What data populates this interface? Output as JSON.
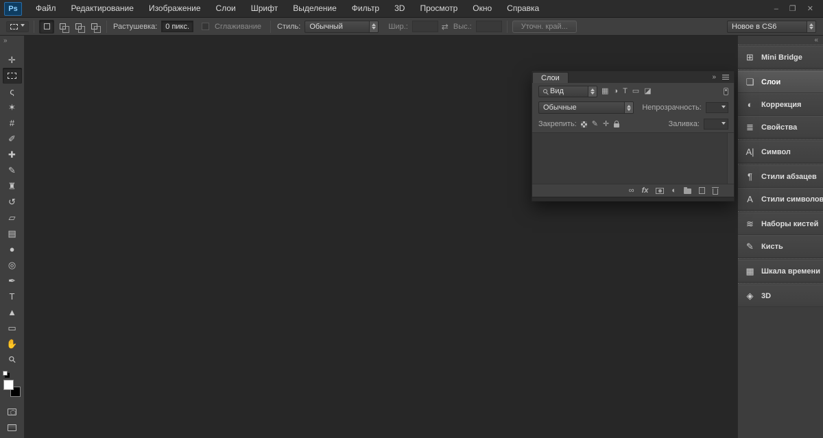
{
  "app": {
    "logo": "Ps",
    "menus": [
      "Файл",
      "Редактирование",
      "Изображение",
      "Слои",
      "Шрифт",
      "Выделение",
      "Фильтр",
      "3D",
      "Просмотр",
      "Окно",
      "Справка"
    ],
    "window_controls": [
      {
        "name": "minimize-button",
        "glyph": "–"
      },
      {
        "name": "restore-button",
        "glyph": "❐"
      },
      {
        "name": "close-button",
        "glyph": "✕"
      }
    ]
  },
  "options_bar": {
    "selection_modes": [
      {
        "name": "new-selection-button",
        "pressed": true
      },
      {
        "name": "add-selection-button",
        "dbl": true
      },
      {
        "name": "subtract-selection-button",
        "dbl": true
      },
      {
        "name": "intersect-selection-button",
        "dbl": true
      }
    ],
    "feather_label": "Растушевка:",
    "feather_value": "0 пикс.",
    "antialias_label": "Сглаживание",
    "style_label": "Стиль:",
    "style_value": "Обычный",
    "width_label": "Шир.:",
    "width_value": "",
    "swap_icon": "⇄",
    "height_label": "Выс.:",
    "height_value": "",
    "refine_edge_label": "Уточн. край...",
    "workspace_value": "Новое в CS6"
  },
  "toolbar": {
    "expand_icon": "»",
    "tools": [
      {
        "name": "move-tool",
        "glyph": "✛"
      },
      {
        "name": "rectangular-marquee-tool",
        "css": "marquee",
        "selected": true
      },
      {
        "name": "lasso-tool",
        "glyph": "ς"
      },
      {
        "name": "quick-selection-tool",
        "glyph": "✶"
      },
      {
        "name": "crop-tool",
        "glyph": "#"
      },
      {
        "name": "eyedropper-tool",
        "glyph": "✐"
      },
      {
        "name": "healing-brush-tool",
        "glyph": "✚"
      },
      {
        "name": "brush-tool",
        "glyph": "✎"
      },
      {
        "name": "clone-stamp-tool",
        "glyph": "♜"
      },
      {
        "name": "history-brush-tool",
        "glyph": "↺"
      },
      {
        "name": "eraser-tool",
        "glyph": "▱"
      },
      {
        "name": "gradient-tool",
        "glyph": "▤"
      },
      {
        "name": "blur-tool",
        "glyph": "●"
      },
      {
        "name": "dodge-tool",
        "glyph": "◎"
      },
      {
        "name": "pen-tool",
        "glyph": "✒"
      },
      {
        "name": "type-tool",
        "glyph": "T"
      },
      {
        "name": "path-selection-tool",
        "glyph": "▲"
      },
      {
        "name": "rectangle-tool",
        "glyph": "▭"
      },
      {
        "name": "hand-tool",
        "glyph": "✋"
      },
      {
        "name": "zoom-tool",
        "glyph": "⚲",
        "rot": true
      }
    ],
    "foreground_color": "#ffffff",
    "background_color": "#000000",
    "tools_bottom": [
      {
        "name": "quick-mask-button",
        "css": "quickmask"
      },
      {
        "name": "screen-mode-button",
        "css": "screenmode"
      }
    ]
  },
  "layers_panel": {
    "title": "Слои",
    "collapse_icon": "»",
    "filter_label": "Вид",
    "filter_icons": [
      {
        "name": "pixel-filter-icon",
        "glyph": "▦"
      },
      {
        "name": "adjustment-filter-icon",
        "glyph": "◑"
      },
      {
        "name": "type-filter-icon",
        "glyph": "T"
      },
      {
        "name": "shape-filter-icon",
        "glyph": "▭"
      },
      {
        "name": "smart-object-filter-icon",
        "glyph": "◪"
      }
    ],
    "blend_mode_value": "Обычные",
    "opacity_label": "Непрозрачность:",
    "opacity_value": "",
    "lock_label": "Закрепить:",
    "lock_icons": [
      {
        "name": "lock-transparency-icon",
        "css": "checker"
      },
      {
        "name": "lock-pixels-icon",
        "glyph": "✎"
      },
      {
        "name": "lock-position-icon",
        "glyph": "✛"
      },
      {
        "name": "lock-all-icon",
        "css": "lock"
      }
    ],
    "fill_label": "Заливка:",
    "fill_value": "",
    "bottom_icons": [
      {
        "name": "link-layers-icon",
        "glyph": "∞"
      },
      {
        "name": "layer-effects-icon",
        "glyph": "fx",
        "fx": true
      },
      {
        "name": "add-mask-icon",
        "css": "mask"
      },
      {
        "name": "adjustment-layer-icon",
        "glyph": "◐"
      },
      {
        "name": "layer-group-icon",
        "css": "folder"
      },
      {
        "name": "new-layer-icon",
        "css": "newlayer"
      },
      {
        "name": "delete-layer-icon",
        "css": "trash"
      }
    ]
  },
  "right_dock": {
    "collapse_icon": "«",
    "groups": [
      [
        {
          "name": "panel-button-mini-bridge",
          "label": "Mini Bridge",
          "glyph": "⊞"
        }
      ],
      [
        {
          "name": "panel-button-layers",
          "label": "Слои",
          "glyph": "❏",
          "active": true
        },
        {
          "name": "panel-button-adjustments",
          "label": "Коррекция",
          "glyph": "◐"
        },
        {
          "name": "panel-button-properties",
          "label": "Свойства",
          "glyph": "≣"
        }
      ],
      [
        {
          "name": "panel-button-character",
          "label": "Символ",
          "glyph": "A|"
        }
      ],
      [
        {
          "name": "panel-button-paragraph-styles",
          "label": "Стили абзацев",
          "glyph": "¶"
        },
        {
          "name": "panel-button-character-styles",
          "label": "Стили символов",
          "glyph": "A"
        }
      ],
      [
        {
          "name": "panel-button-brush-presets",
          "label": "Наборы кистей",
          "glyph": "≋"
        },
        {
          "name": "panel-button-brush",
          "label": "Кисть",
          "glyph": "✎"
        }
      ],
      [
        {
          "name": "panel-button-timeline",
          "label": "Шкала времени",
          "glyph": "▦"
        }
      ],
      [
        {
          "name": "panel-button-3d",
          "label": "3D",
          "glyph": "◈"
        }
      ]
    ]
  }
}
